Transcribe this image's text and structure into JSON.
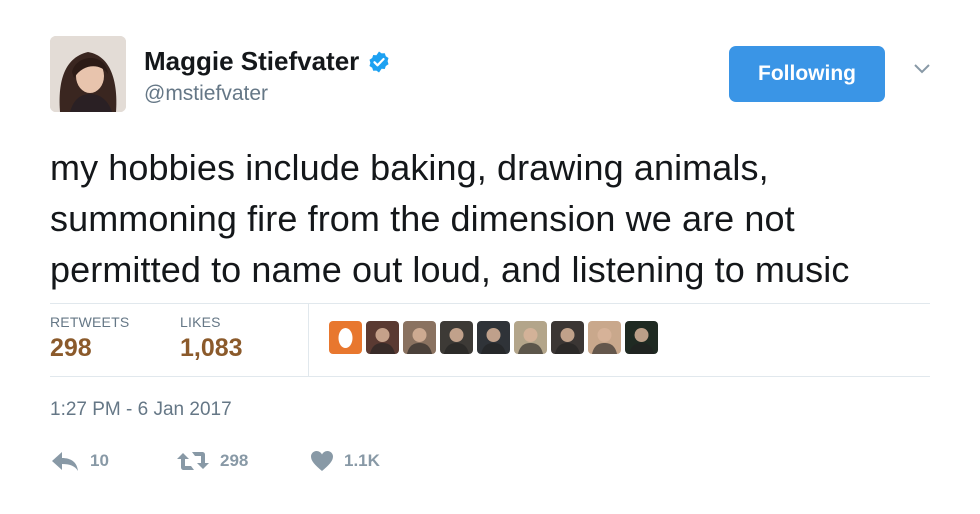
{
  "author": {
    "name": "Maggie Stiefvater",
    "handle": "@mstiefvater",
    "verified": true,
    "avatar_icon": "profile-photo"
  },
  "follow_button": {
    "label": "Following",
    "color": "#3a95e6"
  },
  "menu_icon": "chevron-down-icon",
  "tweet": {
    "text": "my hobbies include baking, drawing animals,\nsummoning fire from the dimension we are not\npermitted to name out loud, and listening to music"
  },
  "stats": {
    "retweets_label": "RETWEETS",
    "retweets_value": "298",
    "likes_label": "LIKES",
    "likes_value": "1,083"
  },
  "likers": [
    {
      "name": "liker-1",
      "color": "#e8772e"
    },
    {
      "name": "liker-2",
      "color": "#5a3a32"
    },
    {
      "name": "liker-3",
      "color": "#8a7260"
    },
    {
      "name": "liker-4",
      "color": "#3d3a36"
    },
    {
      "name": "liker-5",
      "color": "#2f3338"
    },
    {
      "name": "liker-6",
      "color": "#b3a58a"
    },
    {
      "name": "liker-7",
      "color": "#3b3634"
    },
    {
      "name": "liker-8",
      "color": "#c9a88c"
    },
    {
      "name": "liker-9",
      "color": "#1f2a22"
    }
  ],
  "timestamp": "1:27 PM - 6 Jan 2017",
  "actions": {
    "reply_count": "10",
    "retweet_count": "298",
    "like_count": "1.1K"
  }
}
